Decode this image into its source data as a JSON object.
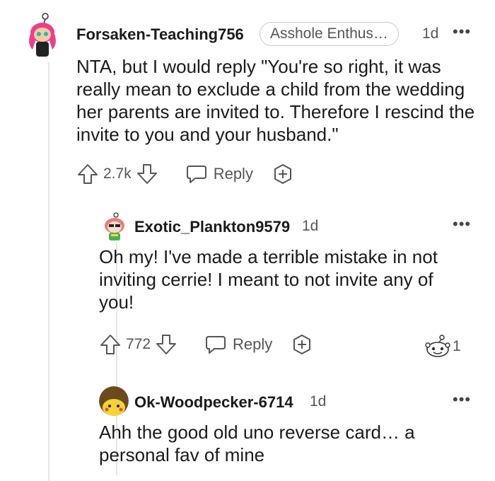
{
  "comments": [
    {
      "username": "Forsaken-Teaching756",
      "flair": "Asshole Enthus…",
      "time": "1d",
      "text": "NTA, but I would reply \"You're so right, it was really mean to exclude a child from the wedding her parents are invited to. Therefore I rescind the invite to you and your husband.\"",
      "votes": "2.7k",
      "reply_label": "Reply"
    },
    {
      "username": "Exotic_Plankton9579",
      "time": "1d",
      "text": "Oh my! I've made a terrible mistake in not inviting cerrie! I meant to not invite any of you!",
      "votes": "772",
      "reply_label": "Reply",
      "award_count": "1"
    },
    {
      "username": "Ok-Woodpecker-6714",
      "time": "1d",
      "text": "Ahh the good old uno reverse card… a personal fav of mine"
    }
  ],
  "more_icon": "more-horizontal-icon",
  "upvote_icon": "arrow-up-icon",
  "downvote_icon": "arrow-down-icon",
  "reply_icon": "speech-bubble-icon",
  "award_icon": "add-award-icon",
  "colors": {
    "text": "#1a1a1b",
    "muted": "#555555",
    "border": "#c9c9c9"
  }
}
